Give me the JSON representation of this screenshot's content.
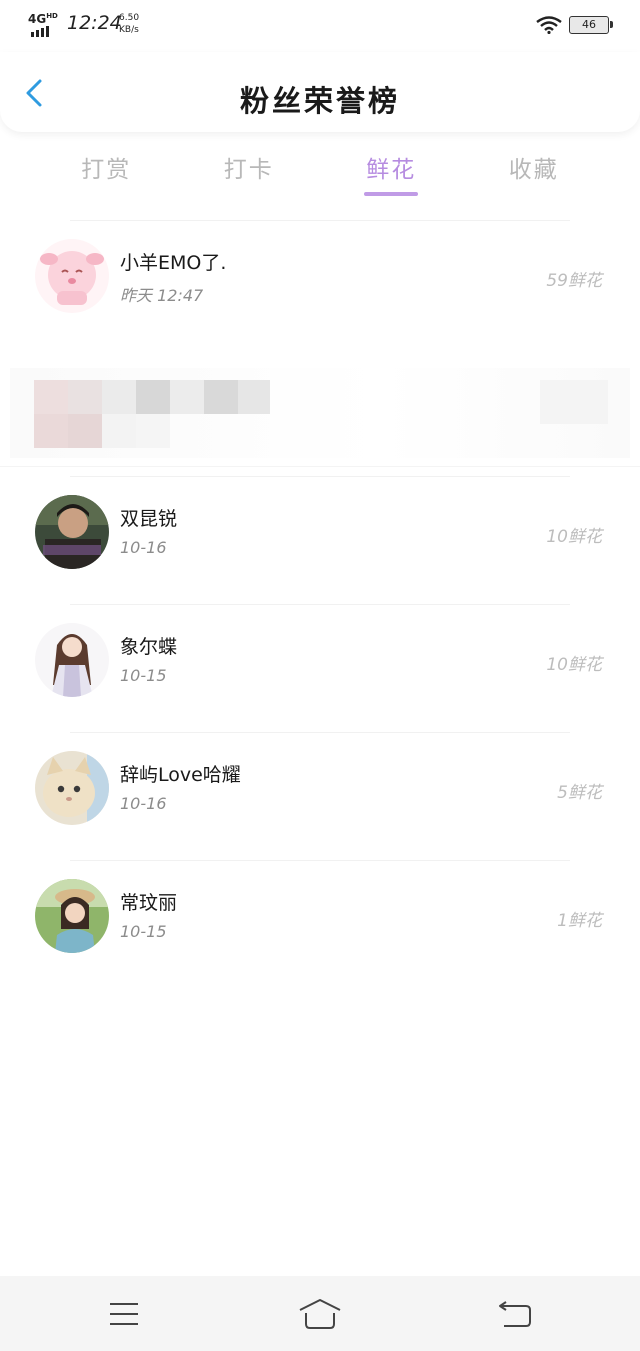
{
  "status_bar": {
    "network": "4G",
    "network_sup": "HD",
    "time": "12:24",
    "speed_value": "6.50",
    "speed_unit": "KB/s",
    "battery": "46"
  },
  "header": {
    "title": "粉丝荣誉榜"
  },
  "tabs": [
    {
      "label": "打赏",
      "active": false
    },
    {
      "label": "打卡",
      "active": false
    },
    {
      "label": "鲜花",
      "active": true
    },
    {
      "label": "收藏",
      "active": false
    }
  ],
  "fans": [
    {
      "name": "小羊EMO了.",
      "time": "昨天 12:47",
      "count": "59鲜花",
      "avatar": "pink-sheep-avatar"
    },
    {
      "name": "双昆锐",
      "time": "10-16",
      "count": "10鲜花",
      "avatar": "man-photo-avatar"
    },
    {
      "name": "象尔蝶",
      "time": "10-15",
      "count": "10鲜花",
      "avatar": "anime-girl-avatar"
    },
    {
      "name": "辞屿Love哈耀",
      "time": "10-16",
      "count": "5鲜花",
      "avatar": "cat-photo-avatar"
    },
    {
      "name": "常玟丽",
      "time": "10-15",
      "count": "1鲜花",
      "avatar": "child-photo-avatar"
    }
  ],
  "colors": {
    "accent": "#b68ce0",
    "muted": "#bdbdbd",
    "back_arrow": "#2f9be0"
  }
}
